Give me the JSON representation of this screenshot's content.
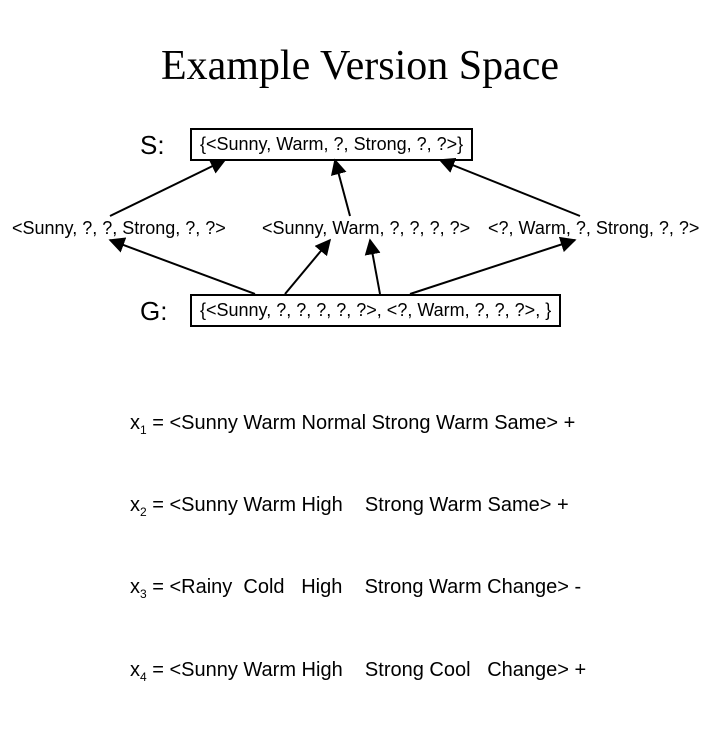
{
  "title": "Example Version Space",
  "labels": {
    "S": "S:",
    "G": "G:"
  },
  "boxes": {
    "S": "{<Sunny, Warm, ?, Strong, ?, ?>}",
    "G": "{<Sunny, ?, ?, ?, ?, ?>, <?, Warm, ?, ?, ?>, }"
  },
  "mid": {
    "h1": "<Sunny, ?, ?, Strong, ?, ?>",
    "h2": "<Sunny, Warm, ?, ?, ?, ?>",
    "h3": "<?, Warm, ?, Strong, ?, ?>"
  },
  "examples": {
    "x1": {
      "var": "x",
      "sub": "1",
      "text": " = <Sunny Warm Normal Strong Warm Same> +"
    },
    "x2": {
      "var": "x",
      "sub": "2",
      "text": " = <Sunny Warm High    Strong Warm Same> +"
    },
    "x3": {
      "var": "x",
      "sub": "3",
      "text": " = <Rainy  Cold   High    Strong Warm Change> -"
    },
    "x4": {
      "var": "x",
      "sub": "4",
      "text": " = <Sunny Warm High    Strong Cool   Change> +"
    }
  }
}
